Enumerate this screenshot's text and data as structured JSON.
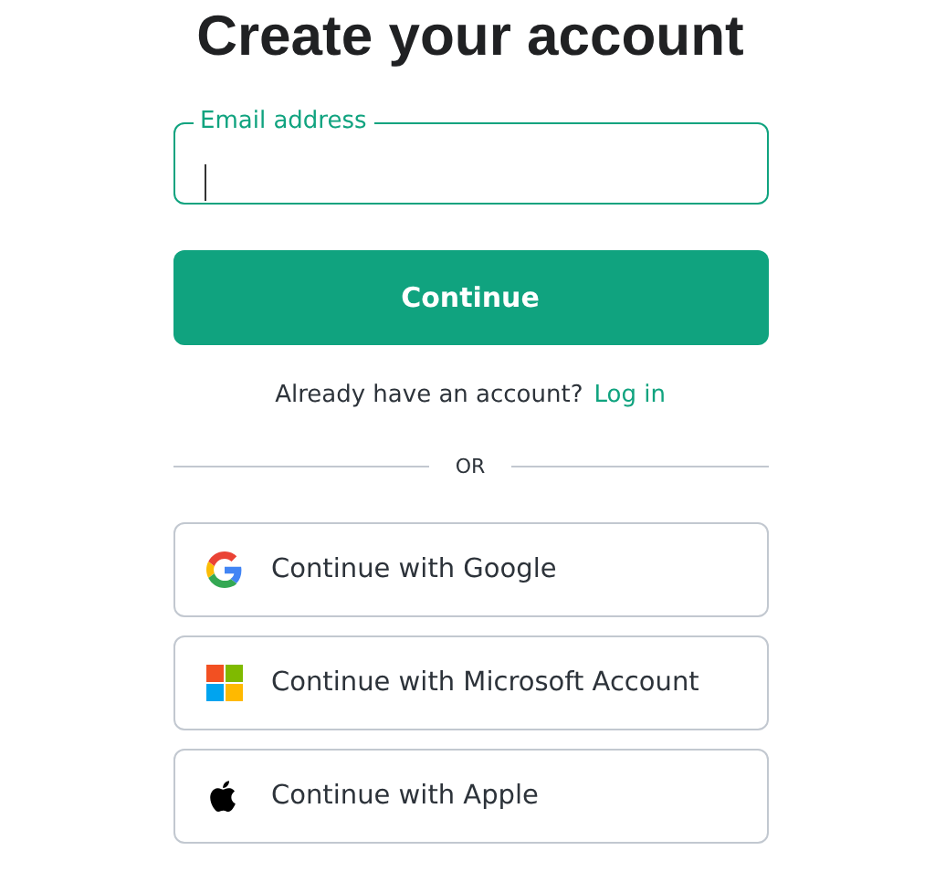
{
  "title": "Create your account",
  "email_field": {
    "label": "Email address",
    "focused": true
  },
  "continue_button": "Continue",
  "login_prompt": {
    "text": "Already have an account?",
    "link": "Log in"
  },
  "divider": "OR",
  "social_buttons": [
    {
      "kind": "google",
      "label": "Continue with Google"
    },
    {
      "kind": "microsoft",
      "label": "Continue with Microsoft Account"
    },
    {
      "kind": "apple",
      "label": "Continue with Apple"
    }
  ]
}
